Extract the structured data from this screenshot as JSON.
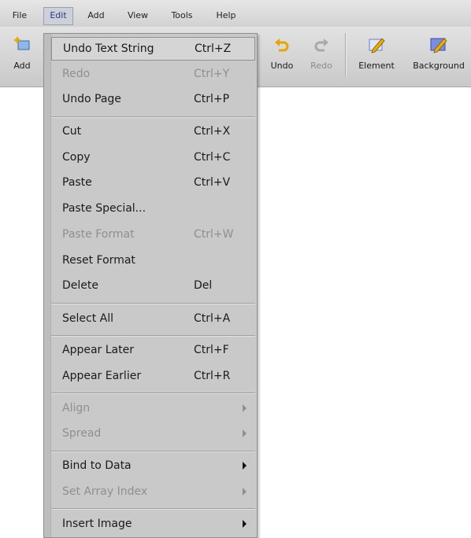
{
  "menubar": {
    "items": [
      {
        "label": "File"
      },
      {
        "label": "Edit"
      },
      {
        "label": "Add"
      },
      {
        "label": "View"
      },
      {
        "label": "Tools"
      },
      {
        "label": "Help"
      }
    ]
  },
  "toolbar": {
    "add_label": "Add",
    "undo_label": "Undo",
    "redo_label": "Redo",
    "element_label": "Element",
    "background_label": "Background"
  },
  "edit_menu": {
    "items": [
      {
        "label": "Undo Text String",
        "shortcut": "Ctrl+Z"
      },
      {
        "label": "Redo",
        "shortcut": "Ctrl+Y"
      },
      {
        "label": "Undo Page",
        "shortcut": "Ctrl+P"
      },
      {
        "label": "Cut",
        "shortcut": "Ctrl+X"
      },
      {
        "label": "Copy",
        "shortcut": "Ctrl+C"
      },
      {
        "label": "Paste",
        "shortcut": "Ctrl+V"
      },
      {
        "label": "Paste Special...",
        "shortcut": ""
      },
      {
        "label": "Paste Format",
        "shortcut": "Ctrl+W"
      },
      {
        "label": "Reset Format",
        "shortcut": ""
      },
      {
        "label": "Delete",
        "shortcut": "Del"
      },
      {
        "label": "Select All",
        "shortcut": "Ctrl+A"
      },
      {
        "label": "Appear Later",
        "shortcut": "Ctrl+F"
      },
      {
        "label": "Appear Earlier",
        "shortcut": "Ctrl+R"
      },
      {
        "label": "Align",
        "shortcut": ""
      },
      {
        "label": "Spread",
        "shortcut": ""
      },
      {
        "label": "Bind to Data",
        "shortcut": ""
      },
      {
        "label": "Set Array Index",
        "shortcut": ""
      },
      {
        "label": "Insert Image",
        "shortcut": ""
      }
    ]
  },
  "colors": {
    "toolbar_bg": "#d6d6d6",
    "menu_bg": "#c9c9c9",
    "disabled_text": "#8f8f8f",
    "undo_icon": "#e8a400",
    "pencil_icon": "#5a6fd8"
  }
}
